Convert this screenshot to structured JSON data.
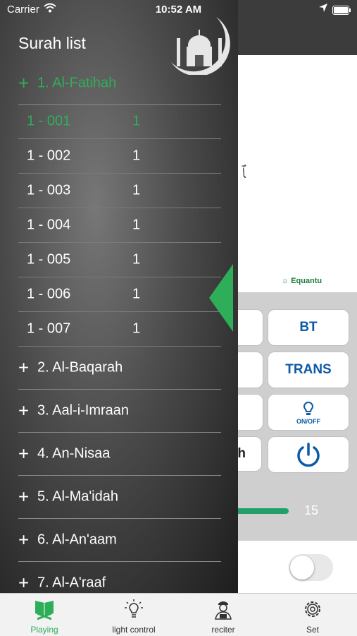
{
  "status": {
    "carrier": "Carrier",
    "time": "10:52 AM"
  },
  "drawer": {
    "title": "Surah list",
    "expanded_surah": "1. Al-Fatihah",
    "ayahs": [
      {
        "code": "1 - 001",
        "num": "1"
      },
      {
        "code": "1 - 002",
        "num": "1"
      },
      {
        "code": "1 - 003",
        "num": "1"
      },
      {
        "code": "1 - 004",
        "num": "1"
      },
      {
        "code": "1 - 005",
        "num": "1"
      },
      {
        "code": "1 - 006",
        "num": "1"
      },
      {
        "code": "1 - 007",
        "num": "1"
      }
    ],
    "surahs": [
      "2. Al-Baqarah",
      "3. Aal-i-Imraan",
      "4. An-Nisaa",
      "5. Al-Ma'idah",
      "6. Al-An'aam",
      "7. Al-A'raaf"
    ],
    "plus": "+"
  },
  "main": {
    "brand": "Equantu",
    "buttons": {
      "bt": "BT",
      "trans": "TRANS",
      "onoff": "ON/OFF",
      "partial_h": "h"
    },
    "slider_value": "15",
    "slider_fraction": 0.9,
    "toggle_on": false
  },
  "tabs": [
    "Playing",
    "light control",
    "reciter",
    "Set"
  ],
  "colors": {
    "accent": "#2fae5a",
    "button_text": "#0d5aa7"
  }
}
